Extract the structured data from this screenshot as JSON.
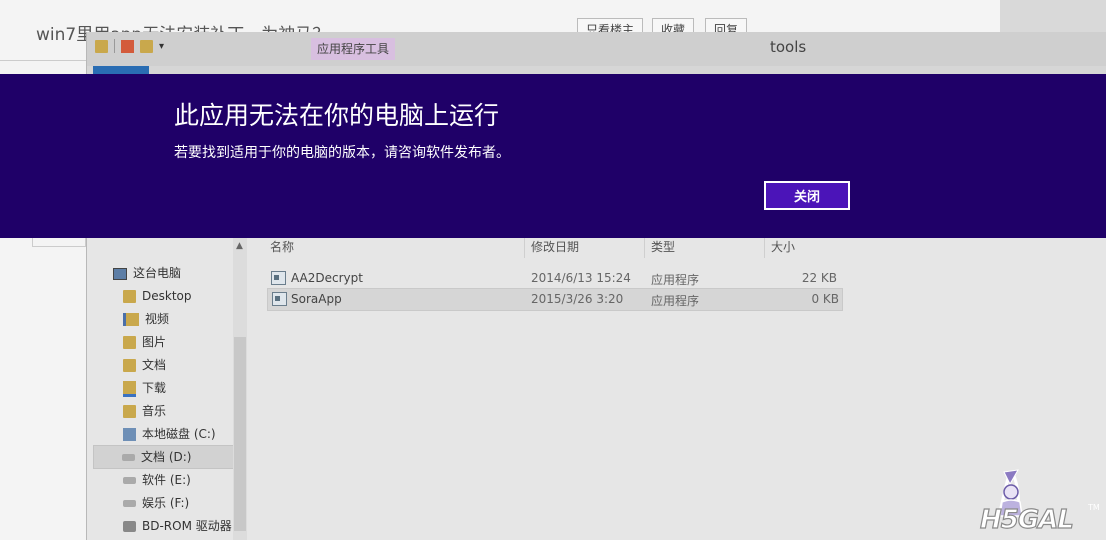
{
  "webpage": {
    "title": "win7里用app无法安装补丁，为神马？",
    "buttons": [
      "只看楼主",
      "收藏",
      "回复"
    ]
  },
  "explorer": {
    "window_title": "tools",
    "contextual_tab": "应用程序工具",
    "nav": [
      {
        "label": "这台电脑",
        "icon": "computer-icon"
      },
      {
        "label": "Desktop",
        "icon": "folder-icon"
      },
      {
        "label": "视频",
        "icon": "videos-folder-icon"
      },
      {
        "label": "图片",
        "icon": "pictures-folder-icon"
      },
      {
        "label": "文档",
        "icon": "documents-folder-icon"
      },
      {
        "label": "下载",
        "icon": "downloads-folder-icon"
      },
      {
        "label": "音乐",
        "icon": "music-folder-icon"
      },
      {
        "label": "本地磁盘 (C:)",
        "icon": "system-drive-icon"
      },
      {
        "label": "文档 (D:)",
        "icon": "drive-icon"
      },
      {
        "label": "软件 (E:)",
        "icon": "drive-icon"
      },
      {
        "label": "娱乐 (F:)",
        "icon": "drive-icon"
      },
      {
        "label": "BD-ROM 驱动器",
        "icon": "optical-drive-icon"
      }
    ],
    "columns": {
      "name": "名称",
      "modified": "修改日期",
      "type": "类型",
      "size": "大小"
    },
    "files": [
      {
        "name": "AA2Decrypt",
        "modified": "2014/6/13 15:24",
        "type": "应用程序",
        "size": "22 KB"
      },
      {
        "name": "SoraApp",
        "modified": "2015/3/26 3:20",
        "type": "应用程序",
        "size": "0 KB"
      }
    ]
  },
  "dialog": {
    "title": "此应用无法在你的电脑上运行",
    "message": "若要找到适用于你的电脑的版本，请咨询软件发布者。",
    "close_label": "关闭"
  },
  "watermark": {
    "text": "H5GAL",
    "mark": "TM"
  },
  "colors": {
    "dialog_background": "#1f0068",
    "dialog_button": "#4b14b8",
    "contextual_tab": "#d8bfe0"
  }
}
